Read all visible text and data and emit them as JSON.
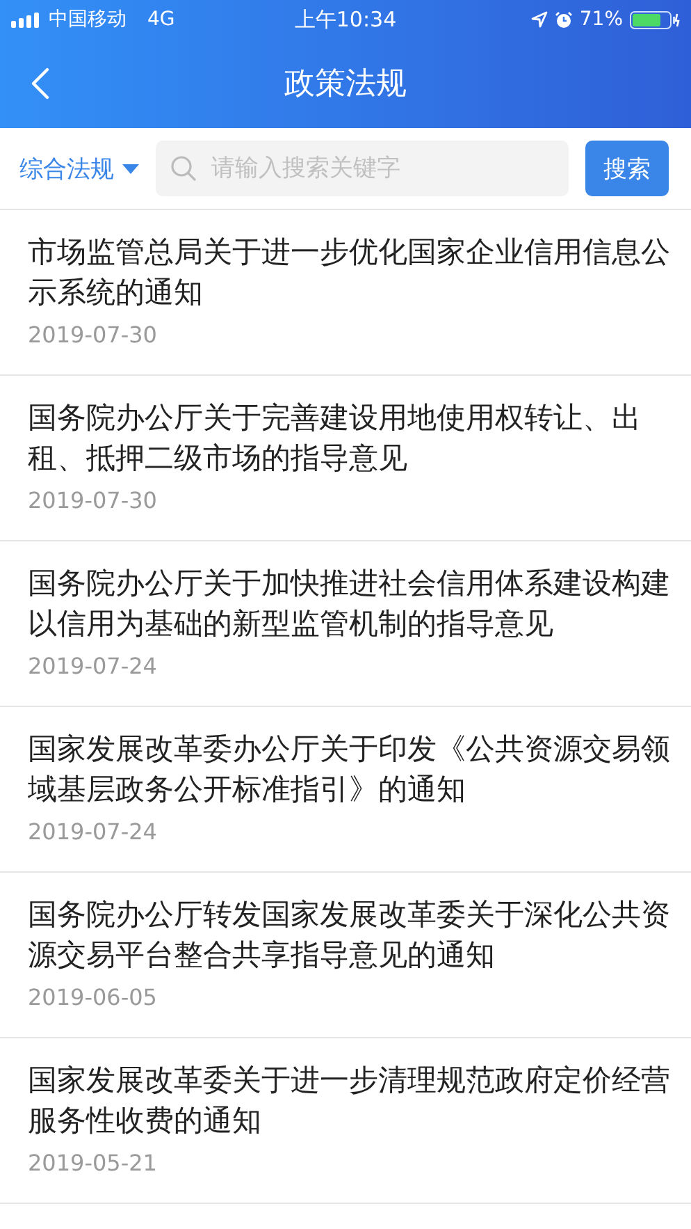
{
  "status_bar": {
    "carrier": "中国移动",
    "network": "4G",
    "time": "上午10:34",
    "battery": "71%"
  },
  "nav": {
    "title": "政策法规"
  },
  "filter": {
    "category": "综合法规",
    "search_placeholder": "请输入搜索关键字",
    "search_button": "搜索"
  },
  "articles": [
    {
      "title": "市场监管总局关于进一步优化国家企业信用信息公示系统的通知",
      "date": "2019-07-30"
    },
    {
      "title": "国务院办公厅关于完善建设用地使用权转让、出租、抵押二级市场的指导意见",
      "date": "2019-07-30"
    },
    {
      "title": "国务院办公厅关于加快推进社会信用体系建设构建以信用为基础的新型监管机制的指导意见",
      "date": "2019-07-24"
    },
    {
      "title": "国家发展改革委办公厅关于印发《公共资源交易领域基层政务公开标准指引》的通知",
      "date": "2019-07-24"
    },
    {
      "title": "国务院办公厅转发国家发展改革委关于深化公共资源交易平台整合共享指导意见的通知",
      "date": "2019-06-05"
    },
    {
      "title": "国家发展改革委关于进一步清理规范政府定价经营服务性收费的通知",
      "date": "2019-05-21"
    }
  ]
}
